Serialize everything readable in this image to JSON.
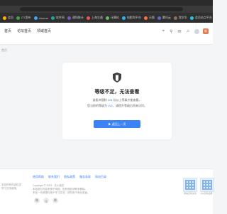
{
  "browser": {
    "bookmarks": [
      {
        "label": "会员",
        "color": "#ffb300"
      },
      {
        "label": "OT发布",
        "color": "#43a047"
      },
      {
        "label": "chrome",
        "color": "#42a5f5"
      },
      {
        "label": "软件网",
        "color": "#26a69a"
      },
      {
        "label": "通知统计",
        "color": "#7e57c2"
      },
      {
        "label": "上海交通",
        "color": "#ef5350"
      },
      {
        "label": "计算机",
        "color": "#66bb6a"
      },
      {
        "label": "电影和平台",
        "color": "#29b6f6"
      },
      {
        "label": "天猫",
        "color": "#ff7043"
      },
      {
        "label": "腾讯云",
        "color": "#5c6bc0"
      },
      {
        "label": "我学生",
        "color": "#8d6e63"
      },
      {
        "label": "会员站点平台",
        "color": "#26c6da"
      },
      {
        "label": "其他",
        "color": "#bdbdbd"
      }
    ]
  },
  "nav": {
    "items": [
      "首页",
      "论坛首页",
      "领域首页"
    ],
    "badge": "新"
  },
  "side_hint": "首页",
  "card": {
    "title": "等级不足，无法查看",
    "line1_prefix": "该板块限制 ",
    "line1_level": "LV4",
    "line1_suffix": " 及以上等级才能查看。",
    "line2_prefix": "您当前的等级为 ",
    "line2_level": "LV1",
    "line2_suffix": "，请提升等级后再来访问。",
    "button": "▶ 返回上一页"
  },
  "footer": {
    "links": [
      "使用帮助",
      "联系我们",
      "隐私政策",
      "服务条款",
      "网站目录"
    ],
    "copy1": "Copyright © 2024 · 天小报志",
    "copy2": "本站部分内容来源于网络，如有侵权请联系删除。",
    "copy3": "本站一切资源均用于学习交流，请勿用于商业用途。",
    "left1": "本站所有内容仅供",
    "left2": "学习交流使用。",
    "social": [
      "微",
      "Q",
      "联"
    ],
    "qr_labels": [
      "微信扫码关注",
      "QQ扫码加群"
    ]
  },
  "colors": {
    "accent": "#3b82f6",
    "shield": "#404040"
  }
}
